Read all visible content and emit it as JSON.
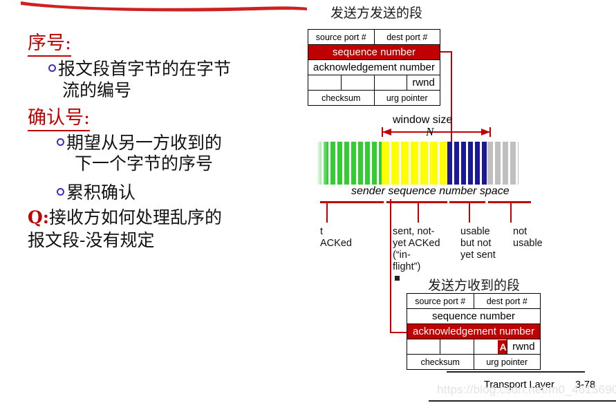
{
  "slide": {
    "footer_title": "Transport Layer",
    "page_number": "3-78",
    "watermark": "https://blog.csdn.net/m0_46156900"
  },
  "left_column": {
    "heading1": "序号:",
    "bullet1_line1": "报文段首字节的在字节",
    "bullet1_line2": "流的编号",
    "heading2": "确认号:",
    "bullet2_line1": "期望从另一方收到的",
    "bullet2_line2": "下一个字节的序号",
    "bullet3": "累积确认",
    "q_label": "Q:",
    "q_line1": "接收方如何处理乱序的",
    "q_line2": "报文段-没有规定"
  },
  "top_segment": {
    "title": "发送方发送的段",
    "rows": [
      {
        "cells": [
          "source port #",
          "dest port #"
        ]
      },
      {
        "cells": [
          "sequence number"
        ],
        "highlight": true
      },
      {
        "cells": [
          "acknowledgement number"
        ]
      },
      {
        "cells": [
          "",
          "",
          "",
          "rwnd"
        ]
      },
      {
        "cells": [
          "checksum",
          "urg pointer"
        ]
      }
    ]
  },
  "bottom_segment": {
    "title": "发送方收到的段",
    "rows": [
      {
        "cells": [
          "source port #",
          "dest port #"
        ]
      },
      {
        "cells": [
          "sequence number"
        ]
      },
      {
        "cells": [
          "acknowledgement number"
        ],
        "highlight": true
      },
      {
        "cells": [
          "",
          "",
          "A",
          "rwnd"
        ]
      },
      {
        "cells": [
          "checksum",
          "urg pointer"
        ]
      }
    ]
  },
  "sequence_space": {
    "window_size_label": "window size",
    "n_label": "N",
    "axis_label": "sender sequence number space",
    "legend": [
      {
        "id": "acked",
        "lines": [
          "t",
          "ACKed"
        ]
      },
      {
        "id": "in-flight",
        "lines": [
          "sent, not-",
          "yet ACKed",
          "(“in-",
          "flight”)"
        ]
      },
      {
        "id": "usable",
        "lines": [
          "usable",
          "but not",
          "yet sent"
        ]
      },
      {
        "id": "not-usable",
        "lines": [
          "not",
          "usable"
        ]
      }
    ],
    "colors": {
      "acked": "#33CC33",
      "in_flight": "#FFFF00",
      "usable": "#1A1A99",
      "not_usable": "#BFBFBF",
      "accent_red": "#C00000"
    }
  }
}
